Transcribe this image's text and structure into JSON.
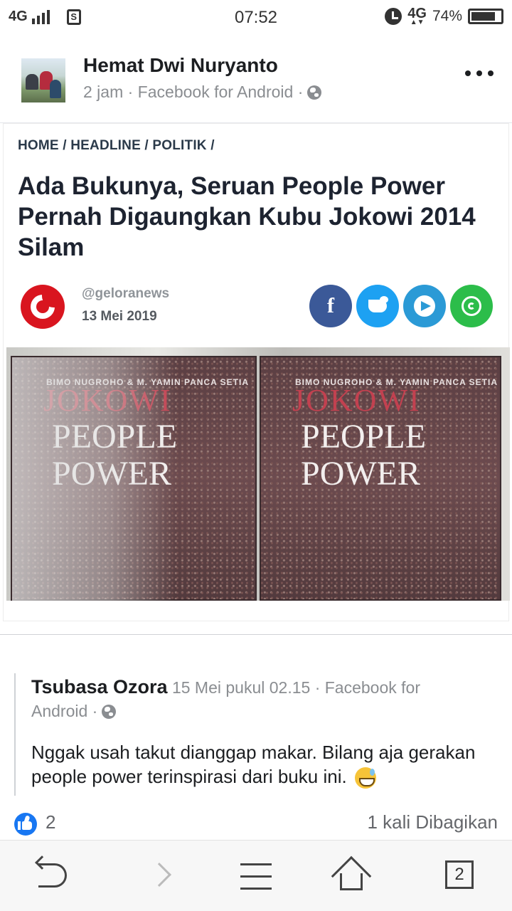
{
  "status_bar": {
    "network_left": "4G",
    "sim_label": "S",
    "time": "07:52",
    "network_right": "4G",
    "battery_pct": "74%",
    "battery_level": 0.74
  },
  "post": {
    "author": "Hemat Dwi Nuryanto",
    "meta": "2 jam · Facebook for Android ·",
    "more_label": "more-options"
  },
  "shared_image": {
    "breadcrumb": "HOME / HEADLINE / POLITIK /",
    "headline": "Ada Bukunya, Seruan People Power Pernah Digaungkan Kubu Jokowi 2014 Silam",
    "publisher_handle": "@geloranews",
    "date": "13 Mei 2019",
    "share_buttons": [
      "facebook",
      "twitter",
      "telegram",
      "whatsapp"
    ],
    "facebook_glyph": "f",
    "book": {
      "authors": "BIMO NUGROHO & M. YAMIN PANCA SETIA",
      "top_word": "JOKOWI",
      "title_line1": "PEOPLE",
      "title_line2": "POWER"
    }
  },
  "shared_post": {
    "author": "Tsubasa Ozora",
    "meta_line1": " 15 Mei pukul 02.15 · Facebook for",
    "meta_line2": "Android ·",
    "text": "Nggak usah takut dianggap makar. Bilang aja gerakan people power terinspirasi dari buku ini."
  },
  "reactions": {
    "like_count": "2",
    "share_count": "1 kali Dibagikan"
  },
  "bottom_nav": {
    "tab_count": "2"
  },
  "colors": {
    "facebook": "#3b5998",
    "twitter": "#1da1f2",
    "telegram": "#2b9ad6",
    "whatsapp": "#2cbd4a",
    "like_blue": "#1877f2",
    "publisher_red": "#d9151f"
  }
}
